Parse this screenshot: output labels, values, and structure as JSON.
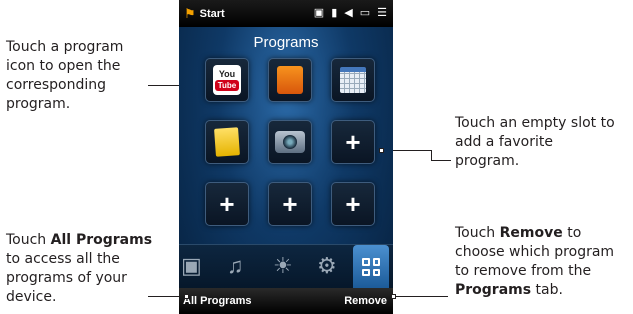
{
  "callouts": {
    "open_program": "Touch a program icon to open the corresponding program.",
    "add_favorite": "Touch an empty slot to add a favorite program.",
    "all_programs_pre": "Touch ",
    "all_programs_bold": "All Programs",
    "all_programs_post": " to access all the programs of your device.",
    "remove_pre": "Touch ",
    "remove_bold": "Remove",
    "remove_mid": " to choose which program to remove from the ",
    "remove_bold2": "Programs",
    "remove_post": " tab."
  },
  "status_bar": {
    "start_label": "Start",
    "icons": [
      "data-icon",
      "signal-icon",
      "volume-icon",
      "battery-icon",
      "menu-icon"
    ]
  },
  "screen": {
    "title": "Programs",
    "slots": [
      {
        "kind": "program",
        "icon": "youtube-icon",
        "youtube_top": "You",
        "youtube_bottom": "Tube"
      },
      {
        "kind": "program",
        "icon": "rss-icon"
      },
      {
        "kind": "program",
        "icon": "calendar-icon"
      },
      {
        "kind": "program",
        "icon": "notes-icon"
      },
      {
        "kind": "program",
        "icon": "camera-icon"
      },
      {
        "kind": "empty",
        "symbol": "+"
      },
      {
        "kind": "empty",
        "symbol": "+"
      },
      {
        "kind": "empty",
        "symbol": "+"
      },
      {
        "kind": "empty",
        "symbol": "+"
      }
    ],
    "tabs": [
      "camera-tab-icon",
      "music-tab-icon",
      "weather-tab-icon",
      "settings-tab-icon",
      "programs-tab-icon"
    ]
  },
  "softkeys": {
    "left": "All Programs",
    "right": "Remove"
  },
  "colors": {
    "accent": "#2b6aa8",
    "active_tab": "#4b90d0",
    "text": "#231f20"
  }
}
